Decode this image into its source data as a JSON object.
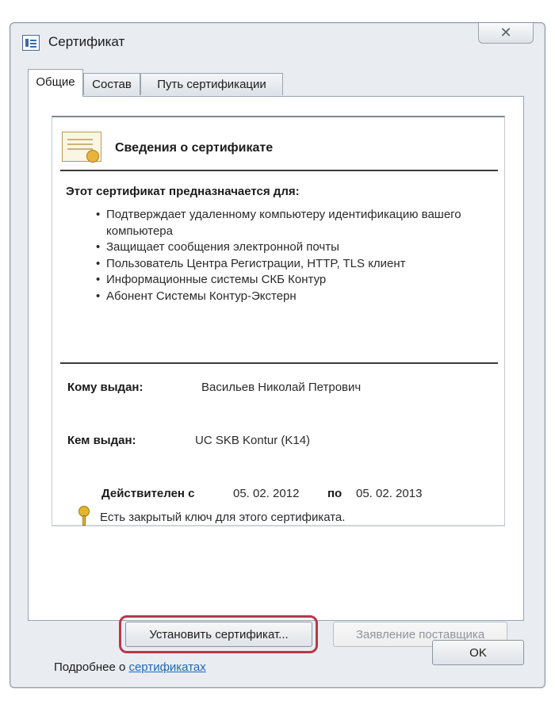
{
  "window": {
    "title": "Сертификат",
    "close_glyph": "✕",
    "icons": {
      "title": "certificate-window-icon",
      "close": "close-icon"
    }
  },
  "tabs": [
    {
      "label": "Общие",
      "active": true
    },
    {
      "label": "Состав",
      "active": false
    },
    {
      "label": "Путь сертификации",
      "active": false
    }
  ],
  "info": {
    "title": "Сведения о сертификате",
    "purpose_heading": "Этот сертификат предназначается для:",
    "purposes": [
      "Подтверждает удаленному компьютеру идентификацию вашего компьютера",
      "Защищает сообщения электронной почты",
      "Пользователь Центра Регистрации, HTTP, TLS клиент",
      "Информационные системы СКБ Контур",
      "Абонент Системы Контур-Экстерн"
    ],
    "issued_to_label": "Кому выдан:",
    "issued_to": "Васильев Николай Петрович",
    "issued_by_label": "Кем выдан:",
    "issued_by": "UC SKB Kontur (K14)",
    "valid_from_label": "Действителен с",
    "valid_from": "05. 02. 2012",
    "valid_to_label": "по",
    "valid_to": "05. 02. 2013",
    "private_key_note": "Есть закрытый ключ для этого сертификата."
  },
  "buttons": {
    "install": "Установить сертификат...",
    "issuer_statement": "Заявление поставщика",
    "ok": "OK"
  },
  "more": {
    "prefix": "Подробнее о ",
    "link": "сертификатах"
  },
  "colors": {
    "accent_highlight": "#b33a4a",
    "link": "#2067b3",
    "window_bg": "#e9edf2"
  }
}
